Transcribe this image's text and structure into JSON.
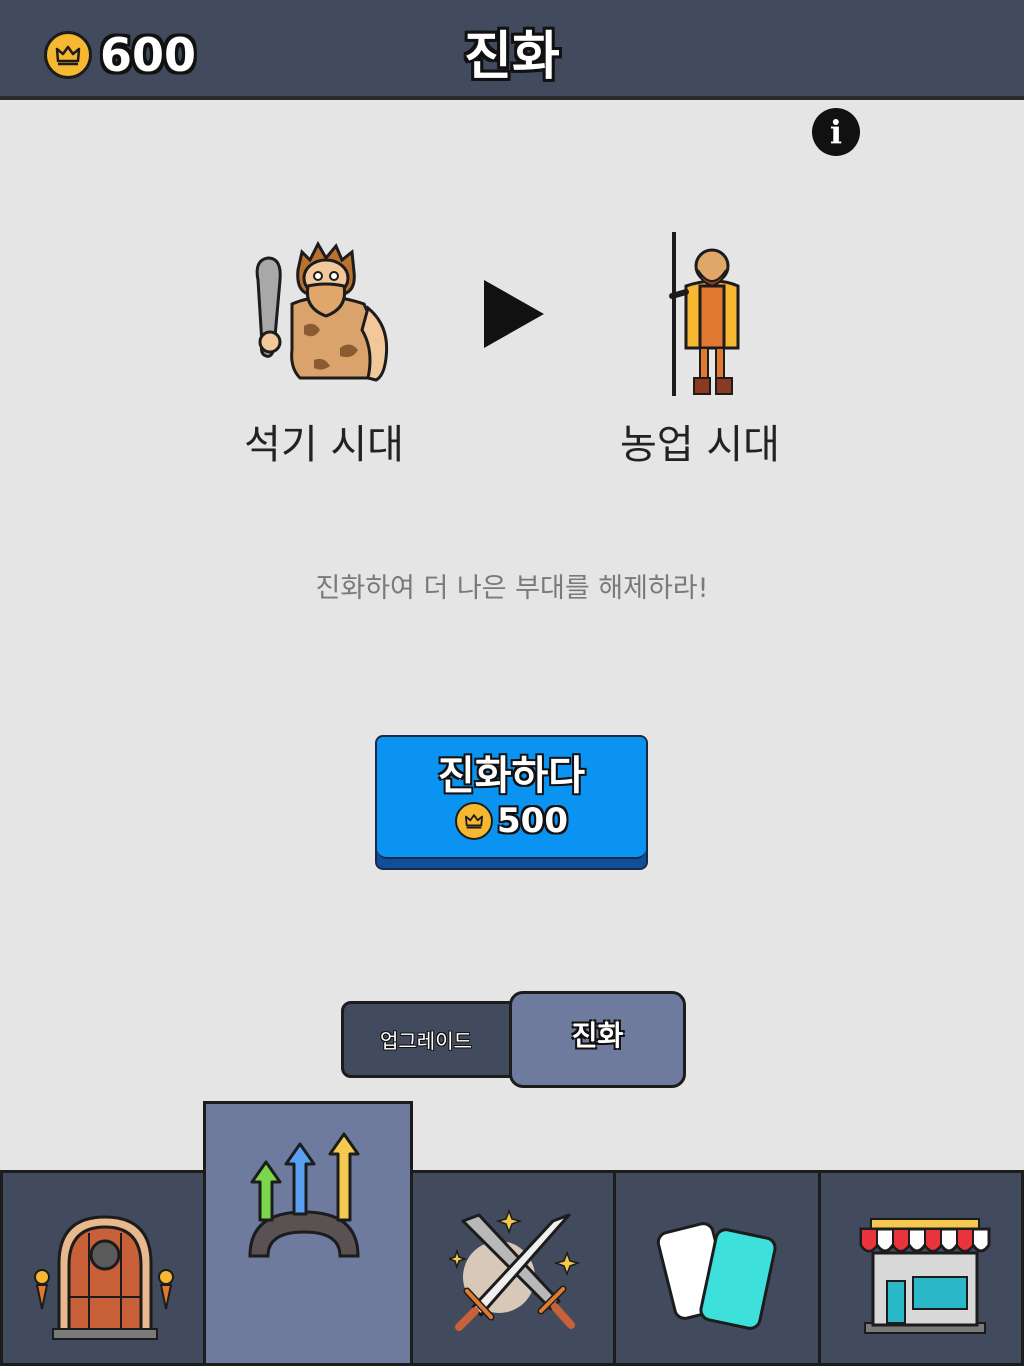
{
  "header": {
    "coins": "600",
    "title": "진화"
  },
  "info_button": {
    "label": "i",
    "icon": "info-icon"
  },
  "eras": {
    "current": {
      "label": "석기 시대",
      "icon": "caveman-icon"
    },
    "next": {
      "label": "농업 시대",
      "icon": "farmer-icon"
    }
  },
  "message": "진화하여 더 나은 부대를 해제하라!",
  "evolve_button": {
    "label": "진화하다",
    "cost": "500"
  },
  "tabs": {
    "upgrade": "업그레이드",
    "evolve": "진화",
    "active": "evolve"
  },
  "bottom_nav": [
    {
      "name": "home",
      "icon": "castle-door-icon"
    },
    {
      "name": "evolution",
      "icon": "evolution-arrows-icon",
      "active": true
    },
    {
      "name": "battle",
      "icon": "crossed-swords-icon"
    },
    {
      "name": "cards",
      "icon": "cards-icon"
    },
    {
      "name": "shop",
      "icon": "shop-icon"
    }
  ],
  "colors": {
    "background": "#e5e5e5",
    "header": "#424a5e",
    "active_slot": "#6e7b9e",
    "evolve_button": "#0b93f2",
    "coin": "#f5b830"
  }
}
